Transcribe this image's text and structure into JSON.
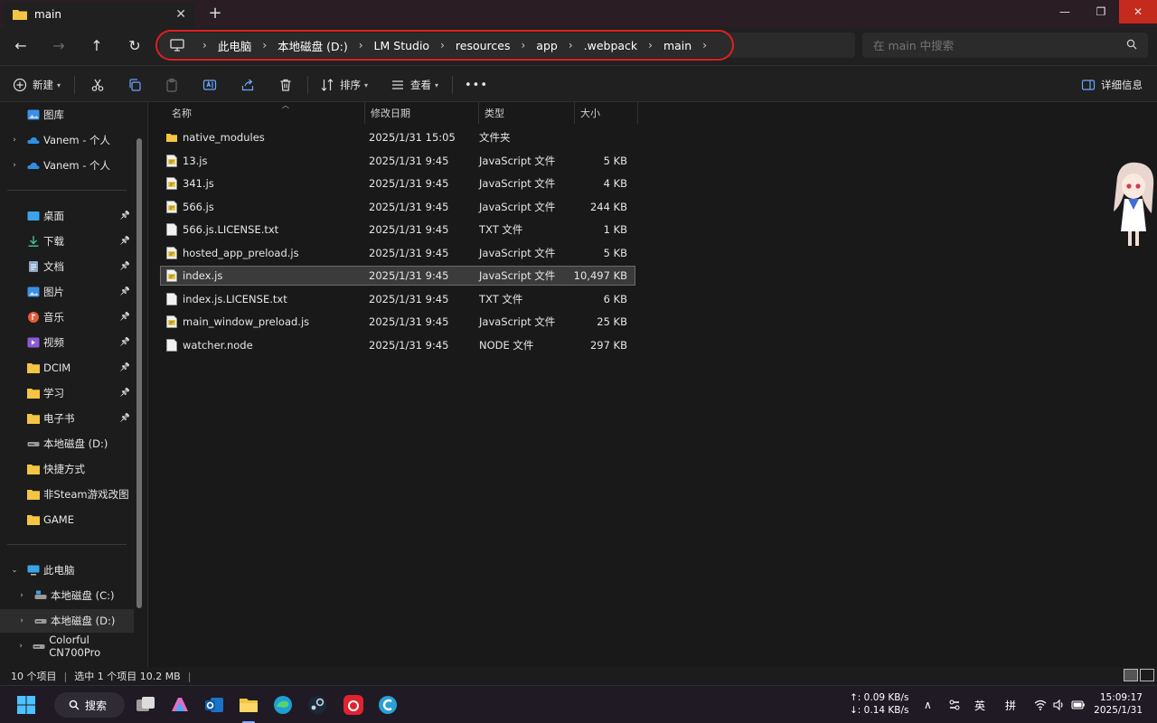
{
  "window": {
    "tab_title": "main",
    "tab_close": "✕",
    "new_tab": "+",
    "minimize": "—",
    "maximize": "❐",
    "close": "✕"
  },
  "nav": {
    "back": "←",
    "forward": "→",
    "up": "↑",
    "refresh": "↻"
  },
  "breadcrumbs": [
    "此电脑",
    "本地磁盘 (D:)",
    "LM Studio",
    "resources",
    "app",
    ".webpack",
    "main"
  ],
  "search": {
    "placeholder": "在 main 中搜索"
  },
  "toolbar": {
    "new_label": "新建",
    "sort_label": "排序",
    "view_label": "查看",
    "more_label": "•••",
    "details_label": "详细信息"
  },
  "sidebar": {
    "top_items": [
      {
        "label": "图库",
        "icon": "gallery-icon"
      },
      {
        "label": "Vanem - 个人",
        "icon": "onedrive-icon"
      },
      {
        "label": "Vanem - 个人",
        "icon": "onedrive-icon"
      }
    ],
    "quick_items": [
      {
        "label": "桌面",
        "icon": "desktop-icon"
      },
      {
        "label": "下载",
        "icon": "download-icon"
      },
      {
        "label": "文档",
        "icon": "document-icon"
      },
      {
        "label": "图片",
        "icon": "pictures-icon"
      },
      {
        "label": "音乐",
        "icon": "music-icon"
      },
      {
        "label": "视频",
        "icon": "video-icon"
      },
      {
        "label": "DCIM",
        "icon": "folder-icon"
      },
      {
        "label": "学习",
        "icon": "folder-icon"
      },
      {
        "label": "电子书",
        "icon": "folder-icon"
      },
      {
        "label": "本地磁盘 (D:)",
        "icon": "drive-icon"
      },
      {
        "label": "快捷方式",
        "icon": "folder-icon"
      },
      {
        "label": "非Steam游戏改图",
        "icon": "folder-icon"
      },
      {
        "label": "GAME",
        "icon": "folder-icon"
      }
    ],
    "this_pc": "此电脑",
    "drives": [
      {
        "label": "本地磁盘 (C:)"
      },
      {
        "label": "本地磁盘 (D:)"
      },
      {
        "label": "Colorful CN700Pro"
      }
    ]
  },
  "columns": {
    "name": "名称",
    "modified": "修改日期",
    "type": "类型",
    "size": "大小"
  },
  "files": [
    {
      "name": "native_modules",
      "modified": "2025/1/31 15:05",
      "type": "文件夹",
      "size": "",
      "kind": "folder"
    },
    {
      "name": "13.js",
      "modified": "2025/1/31 9:45",
      "type": "JavaScript 文件",
      "size": "5 KB",
      "kind": "js"
    },
    {
      "name": "341.js",
      "modified": "2025/1/31 9:45",
      "type": "JavaScript 文件",
      "size": "4 KB",
      "kind": "js"
    },
    {
      "name": "566.js",
      "modified": "2025/1/31 9:45",
      "type": "JavaScript 文件",
      "size": "244 KB",
      "kind": "js"
    },
    {
      "name": "566.js.LICENSE.txt",
      "modified": "2025/1/31 9:45",
      "type": "TXT 文件",
      "size": "1 KB",
      "kind": "txt"
    },
    {
      "name": "hosted_app_preload.js",
      "modified": "2025/1/31 9:45",
      "type": "JavaScript 文件",
      "size": "5 KB",
      "kind": "js"
    },
    {
      "name": "index.js",
      "modified": "2025/1/31 9:45",
      "type": "JavaScript 文件",
      "size": "10,497 KB",
      "kind": "js",
      "selected": true
    },
    {
      "name": "index.js.LICENSE.txt",
      "modified": "2025/1/31 9:45",
      "type": "TXT 文件",
      "size": "6 KB",
      "kind": "txt"
    },
    {
      "name": "main_window_preload.js",
      "modified": "2025/1/31 9:45",
      "type": "JavaScript 文件",
      "size": "25 KB",
      "kind": "js"
    },
    {
      "name": "watcher.node",
      "modified": "2025/1/31 9:45",
      "type": "NODE 文件",
      "size": "297 KB",
      "kind": "txt"
    }
  ],
  "status": {
    "count": "10 个项目",
    "selection": "选中 1 个项目  10.2 MB"
  },
  "taskbar": {
    "search_label": "搜索",
    "net_up": "↑: 0.09 KB/s",
    "net_down": "↓: 0.14 KB/s",
    "ime_lang": "英",
    "ime_mode": "拼",
    "time": "15:09:17",
    "date": "2025/1/31"
  },
  "colors": {
    "accent": "#e01f1f",
    "folder": "#f4c542",
    "close_red": "#c42b1c"
  }
}
